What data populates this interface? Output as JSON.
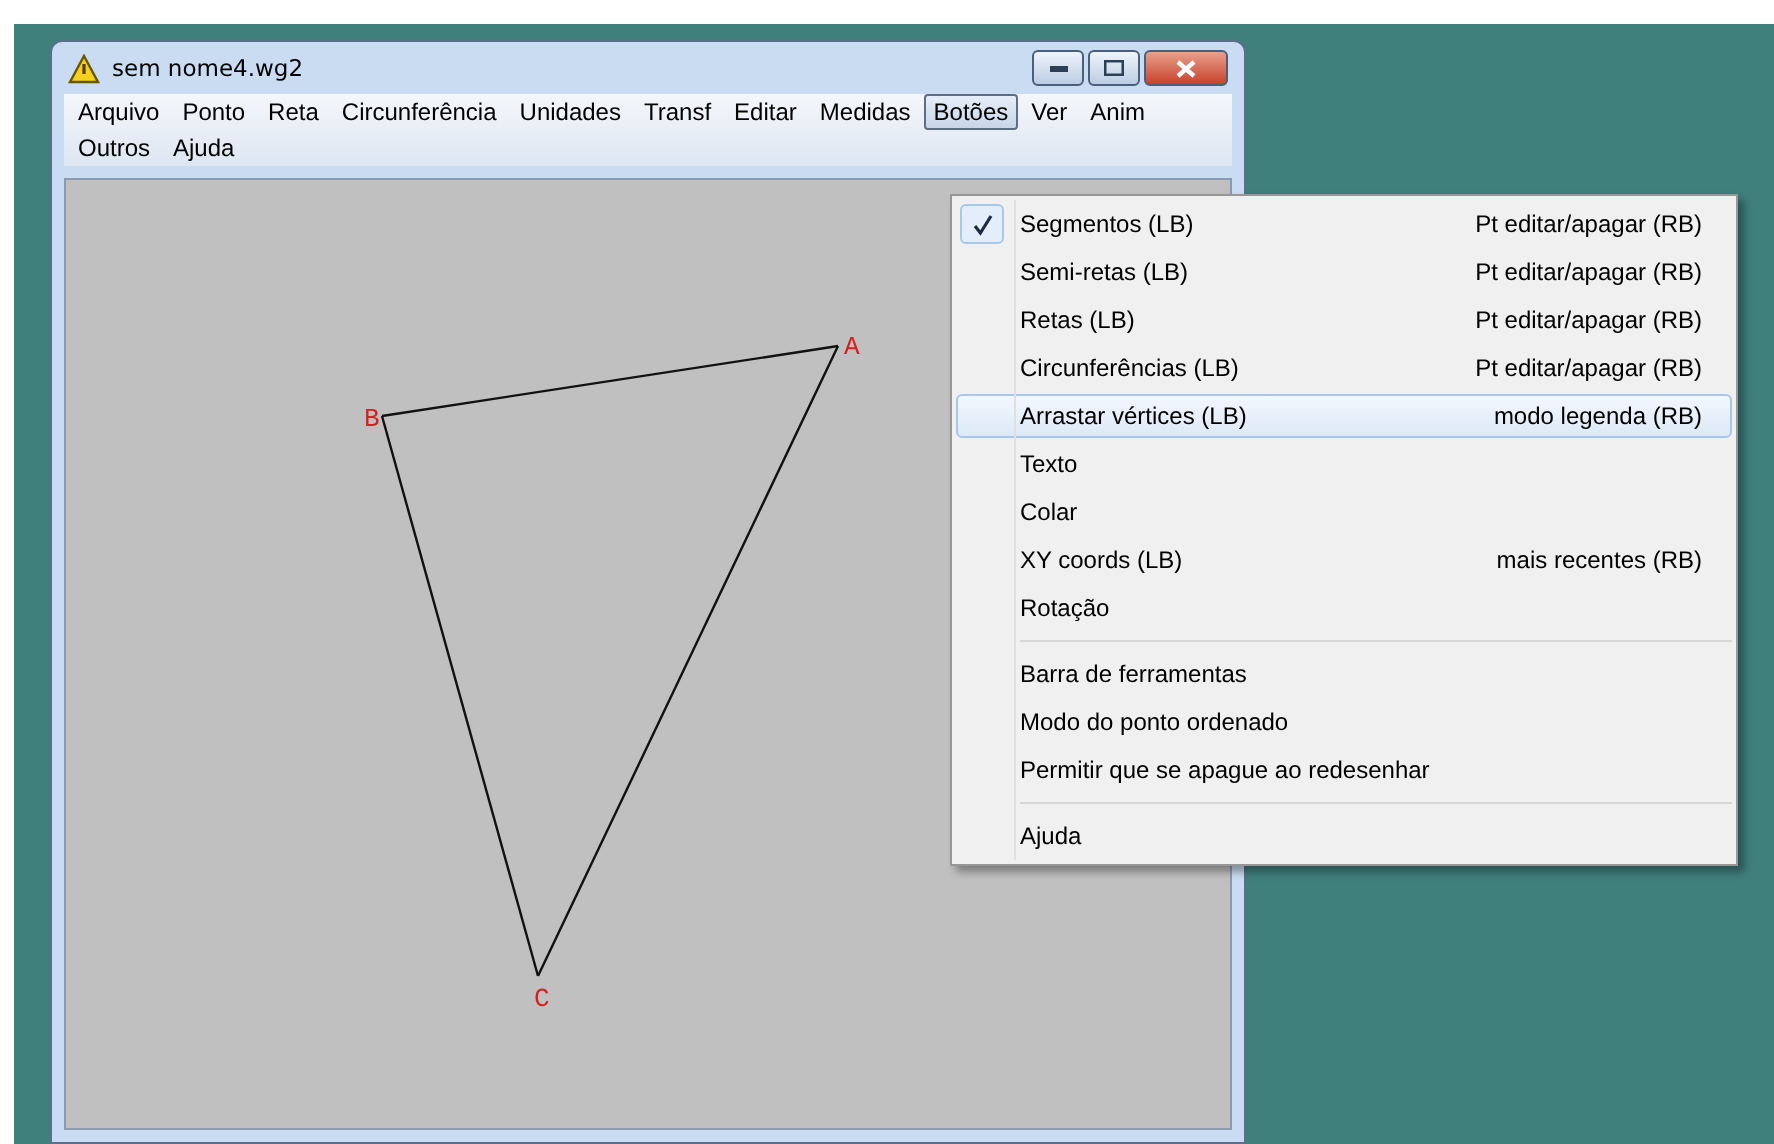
{
  "window": {
    "title": "sem nome4.wg2"
  },
  "menu_rows": [
    [
      {
        "label": "Arquivo",
        "selected": false
      },
      {
        "label": "Ponto",
        "selected": false
      },
      {
        "label": "Reta",
        "selected": false
      },
      {
        "label": "Circunferência",
        "selected": false
      },
      {
        "label": "Unidades",
        "selected": false
      },
      {
        "label": "Transf",
        "selected": false
      },
      {
        "label": "Editar",
        "selected": false
      },
      {
        "label": "Medidas",
        "selected": false
      },
      {
        "label": "Botões",
        "selected": true
      },
      {
        "label": "Ver",
        "selected": false
      },
      {
        "label": "Anim",
        "selected": false
      }
    ],
    [
      {
        "label": "Outros",
        "selected": false
      },
      {
        "label": "Ajuda",
        "selected": false
      }
    ]
  ],
  "dropdown": {
    "groups": [
      [
        {
          "label": "Segmentos (LB)",
          "shortcut": "Pt editar/apagar (RB)",
          "checked": true,
          "selected": false
        },
        {
          "label": "Semi-retas (LB)",
          "shortcut": "Pt editar/apagar (RB)",
          "checked": false,
          "selected": false
        },
        {
          "label": "Retas (LB)",
          "shortcut": "Pt editar/apagar (RB)",
          "checked": false,
          "selected": false
        },
        {
          "label": "Circunferências (LB)",
          "shortcut": "Pt editar/apagar (RB)",
          "checked": false,
          "selected": false
        },
        {
          "label": "Arrastar vértices (LB)",
          "shortcut": "modo legenda (RB)",
          "checked": false,
          "selected": true
        },
        {
          "label": "Texto",
          "checked": false,
          "selected": false
        },
        {
          "label": "Colar",
          "checked": false,
          "selected": false
        },
        {
          "label": "XY coords (LB)",
          "shortcut": "mais recentes (RB)",
          "checked": false,
          "selected": false
        },
        {
          "label": "Rotação",
          "checked": false,
          "selected": false
        }
      ],
      [
        {
          "label": "Barra de ferramentas",
          "checked": false,
          "selected": false
        },
        {
          "label": "Modo do ponto ordenado",
          "checked": false,
          "selected": false
        },
        {
          "label": "Permitir que se apague ao redesenhar",
          "checked": false,
          "selected": false
        }
      ],
      [
        {
          "label": "Ajuda",
          "checked": false,
          "selected": false
        }
      ]
    ]
  },
  "canvas": {
    "points": [
      {
        "label": "A"
      },
      {
        "label": "B"
      },
      {
        "label": "C"
      }
    ]
  }
}
